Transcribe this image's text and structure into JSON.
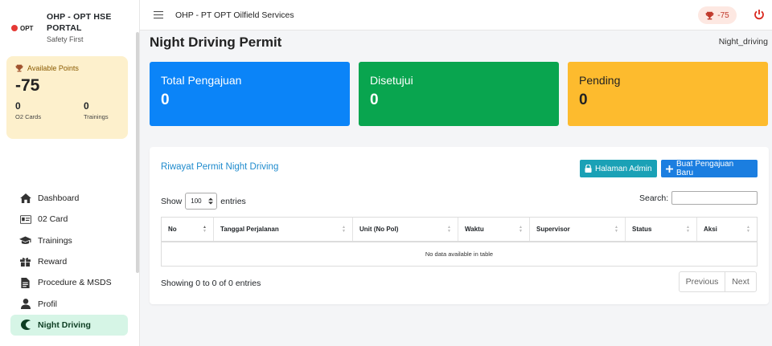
{
  "brand": {
    "logo_text": "OPT",
    "title": "OHP - OPT HSE PORTAL",
    "subtitle": "Safety First"
  },
  "points_card": {
    "label": "Available Points",
    "value": "-75",
    "stats": [
      {
        "value": "0",
        "label": "O2 Cards"
      },
      {
        "value": "0",
        "label": "Trainings"
      }
    ]
  },
  "sidebar": {
    "items": [
      {
        "label": "Dashboard",
        "icon": "home-icon",
        "active": false
      },
      {
        "label": "02 Card",
        "icon": "id-card-icon",
        "active": false
      },
      {
        "label": "Trainings",
        "icon": "graduation-cap-icon",
        "active": false
      },
      {
        "label": "Reward",
        "icon": "gift-icon",
        "active": false
      },
      {
        "label": "Procedure & MSDS",
        "icon": "document-icon",
        "active": false
      },
      {
        "label": "Profil",
        "icon": "user-icon",
        "active": false
      },
      {
        "label": "Night Driving",
        "icon": "moon-icon",
        "active": true
      }
    ]
  },
  "topbar": {
    "title": "OHP - PT OPT Oilfield Services",
    "points": "-75"
  },
  "page": {
    "title": "Night Driving Permit",
    "crumb": "Night_driving"
  },
  "cards": [
    {
      "label": "Total Pengajuan",
      "value": "0",
      "color": "#0b84f8"
    },
    {
      "label": "Disetujui",
      "value": "0",
      "color": "#09a54f"
    },
    {
      "label": "Pending",
      "value": "0",
      "color": "#fdbb2e"
    }
  ],
  "panel": {
    "title": "Riwayat Permit Night Driving",
    "admin_button": "Halaman Admin",
    "new_button": "Buat Pengajuan Baru",
    "show_label": "Show",
    "entries_value": "100",
    "entries_label": "entries",
    "search_label": "Search:",
    "search_value": "",
    "columns": [
      "No",
      "Tanggal Perjalanan",
      "Unit (No Pol)",
      "Waktu",
      "Supervisor",
      "Status",
      "Aksi"
    ],
    "empty_text": "No data available in table",
    "info": "Showing 0 to 0 of 0 entries",
    "prev": "Previous",
    "next": "Next"
  },
  "colors": {
    "accent": "#1f8bcd",
    "active_nav_bg": "#d6f5e6",
    "points_bg": "#fdf0cc"
  }
}
